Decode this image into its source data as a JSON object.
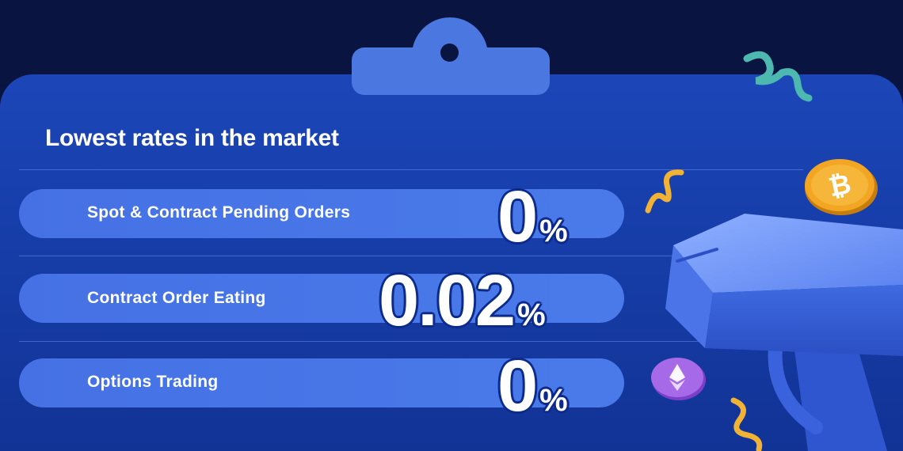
{
  "banner": {
    "title": "Lowest rates in the market",
    "rows": [
      {
        "label": "Spot & Contract Pending Orders",
        "rate": "0",
        "unit": "%"
      },
      {
        "label": "Contract Order Eating",
        "rate": "0.02",
        "unit": "%"
      },
      {
        "label": "Options Trading",
        "rate": "0",
        "unit": "%"
      }
    ]
  },
  "icons": {
    "bitcoin": "bitcoin-coin-icon",
    "ethereum": "ethereum-coin-icon",
    "gun": "money-gun-illustration"
  },
  "colors": {
    "background": "#0a1440",
    "panel": "#1c46b8",
    "pill": "#4571e4",
    "bitcoin": "#f2a623",
    "ethereum": "#a66ae8"
  }
}
